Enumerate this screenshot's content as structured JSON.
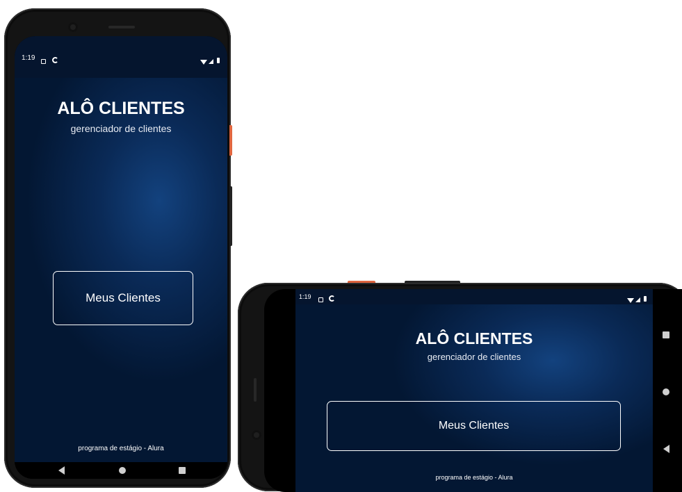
{
  "status_bar": {
    "time": "1:19",
    "left_icons": [
      "notification-box-icon",
      "data-saver-icon"
    ],
    "right_icons": [
      "wifi-icon",
      "cell-signal-icon",
      "battery-icon"
    ]
  },
  "app": {
    "title": "ALÔ CLIENTES",
    "subtitle": "gerenciador de clientes",
    "primary_button": "Meus Clientes",
    "footer": "programa de estágio - Alura"
  },
  "nav_bar": {
    "buttons": [
      "back-icon",
      "home-icon",
      "recents-icon"
    ]
  },
  "colors": {
    "background_dark": "#031733",
    "background_glow": "#13427e",
    "text": "#ffffff",
    "button_border": "#ffffff",
    "device_accent": "#e0663f"
  }
}
